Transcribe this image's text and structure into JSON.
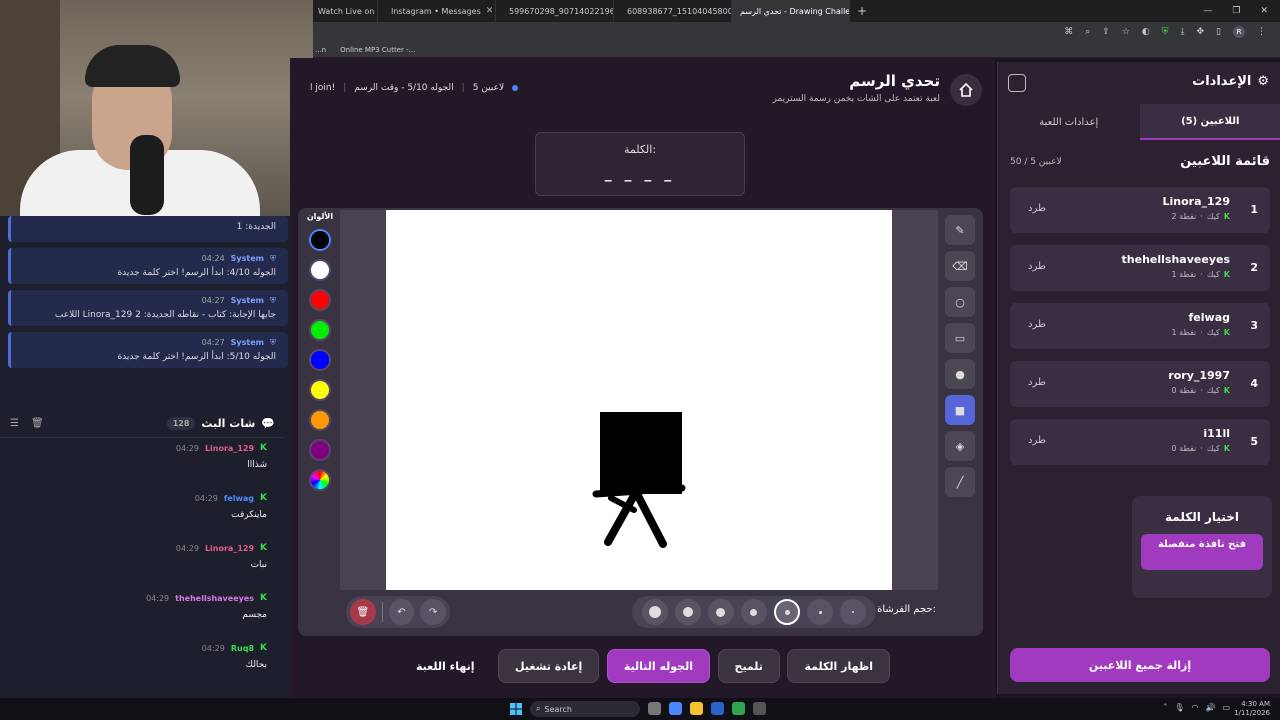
{
  "browser": {
    "tabs": [
      {
        "label": "Watch Live on Ki...",
        "color": "#53fc18"
      },
      {
        "label": "Instagram • Messages",
        "color": "#e1306c"
      },
      {
        "label": "599670298_9071402219691732...",
        "color": "#1877f2"
      },
      {
        "label": "608938677_1510404580004683...",
        "color": "#1877f2"
      },
      {
        "label": "تحدي الرسم - Drawing Challenge",
        "color": "#888888",
        "active": true
      }
    ],
    "bookmarks": [
      "...n",
      "Online MP3 Cutter -..."
    ],
    "profile_initial": "R"
  },
  "game": {
    "title": "تحدي الرسم",
    "subtitle": "لعبة تعتمد على الشات يخمن رسمة الستريمر",
    "players_label": "5 لاعبين",
    "round_label": "الجوله 5/10 - وقت الرسم",
    "join_label": "ا join!",
    "word_label": "الكلمة:",
    "word_blanks": "_ _ _ _",
    "colors_label": "الألوان",
    "colors": [
      "#000000",
      "#ffffff",
      "#ff0000",
      "#00ee00",
      "#0000ff",
      "#ffff00",
      "#ff9900",
      "#800080"
    ],
    "brush_label": "حجم الفرشاة:",
    "actions": {
      "reveal": "اظهار الكلمة",
      "hint": "تلميح",
      "next": "الجوله التالية",
      "restart": "إعادة تشغيل",
      "end": "إنهاء اللعبة"
    }
  },
  "system_messages": [
    {
      "who": "System",
      "time": "",
      "text": "الجديدة: 1"
    },
    {
      "who": "System",
      "time": "04:24",
      "text": "الجوله 4/10: ابدأ الرسم! اختر كلمة جديدة"
    },
    {
      "who": "System",
      "time": "04:27",
      "text": "اللاعب Linora_129 جابها الإجابة: كتاب - نقاطه الجديدة: 2"
    },
    {
      "who": "System",
      "time": "04:27",
      "text": "الجوله 5/10: ابدأ الرسم! اختر كلمة جديدة"
    }
  ],
  "chat": {
    "title": "شات البث",
    "count": "128",
    "messages": [
      {
        "user": "Linora_129",
        "time": "04:29",
        "text": "شذااا",
        "color": "#e35d8a"
      },
      {
        "user": "felwag",
        "time": "04:29",
        "text": "ماينكرفت",
        "color": "#4c8dff"
      },
      {
        "user": "Linora_129",
        "time": "04:29",
        "text": "نبات",
        "color": "#e35d8a"
      },
      {
        "user": "thehellshaveeyes",
        "time": "04:29",
        "text": "مجسم",
        "color": "#d77ae6"
      },
      {
        "user": "Ruq8",
        "time": "04:29",
        "text": "بحالك",
        "color": "#3cdb4a"
      }
    ]
  },
  "settings": {
    "title": "الإعدادات",
    "tab_players": "اللاعبين (5)",
    "tab_game": "إعدادات اللعبة",
    "players_header": "قائمة اللاعبين",
    "players_count": "50 / 5 لاعبين",
    "kick_label": "طرد",
    "platform": "كيك",
    "players": [
      {
        "rank": "1",
        "name": "Linora_129",
        "points": "2 نقطة"
      },
      {
        "rank": "2",
        "name": "thehellshaveeyes",
        "points": "1 نقطة"
      },
      {
        "rank": "3",
        "name": "felwag",
        "points": "1 نقطة"
      },
      {
        "rank": "4",
        "name": "rory_1997",
        "points": "0 نقطة"
      },
      {
        "rank": "5",
        "name": "i11ll",
        "points": "0 نقطة"
      }
    ],
    "word_pick_title": "اختيار الكلمة",
    "word_pick_button": "فتح نافذة منفصلة",
    "remove_all": "إزالة جميع اللاعبين"
  },
  "taskbar": {
    "search": "Search",
    "time": "4:30 AM",
    "date": "1/11/2026"
  }
}
